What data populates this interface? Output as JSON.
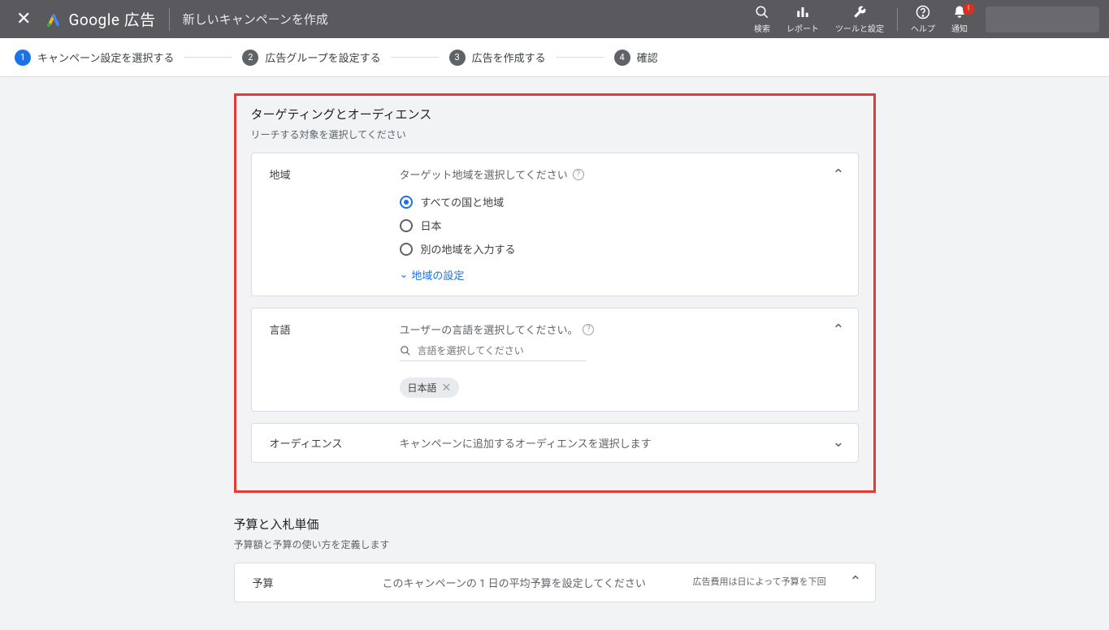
{
  "header": {
    "brand": "Google 広告",
    "page_title": "新しいキャンペーンを作成",
    "tools": {
      "search": "検索",
      "report": "レポート",
      "tools": "ツールと設定",
      "help": "ヘルプ",
      "notify": "通知",
      "notify_badge": "!"
    }
  },
  "stepper": {
    "steps": [
      {
        "num": "1",
        "label": "キャンペーン設定を選択する"
      },
      {
        "num": "2",
        "label": "広告グループを設定する"
      },
      {
        "num": "3",
        "label": "広告を作成する"
      },
      {
        "num": "4",
        "label": "確認"
      }
    ]
  },
  "targeting": {
    "title": "ターゲティングとオーディエンス",
    "subtitle": "リーチする対象を選択してください",
    "region": {
      "label": "地域",
      "hint": "ターゲット地域を選択してください",
      "option_all": "すべての国と地域",
      "option_jp": "日本",
      "option_other": "別の地域を入力する",
      "settings_link": "地域の設定"
    },
    "language": {
      "label": "言語",
      "hint": "ユーザーの言語を選択してください。",
      "placeholder": "言語を選択してください",
      "chip": "日本語"
    },
    "audience": {
      "label": "オーディエンス",
      "desc": "キャンペーンに追加するオーディエンスを選択します"
    }
  },
  "budget": {
    "title": "予算と入札単価",
    "subtitle": "予算額と予算の使い方を定義します",
    "label": "予算",
    "desc": "このキャンペーンの 1 日の平均予算を設定してください",
    "info": "広告費用は日によって予算を下回"
  }
}
